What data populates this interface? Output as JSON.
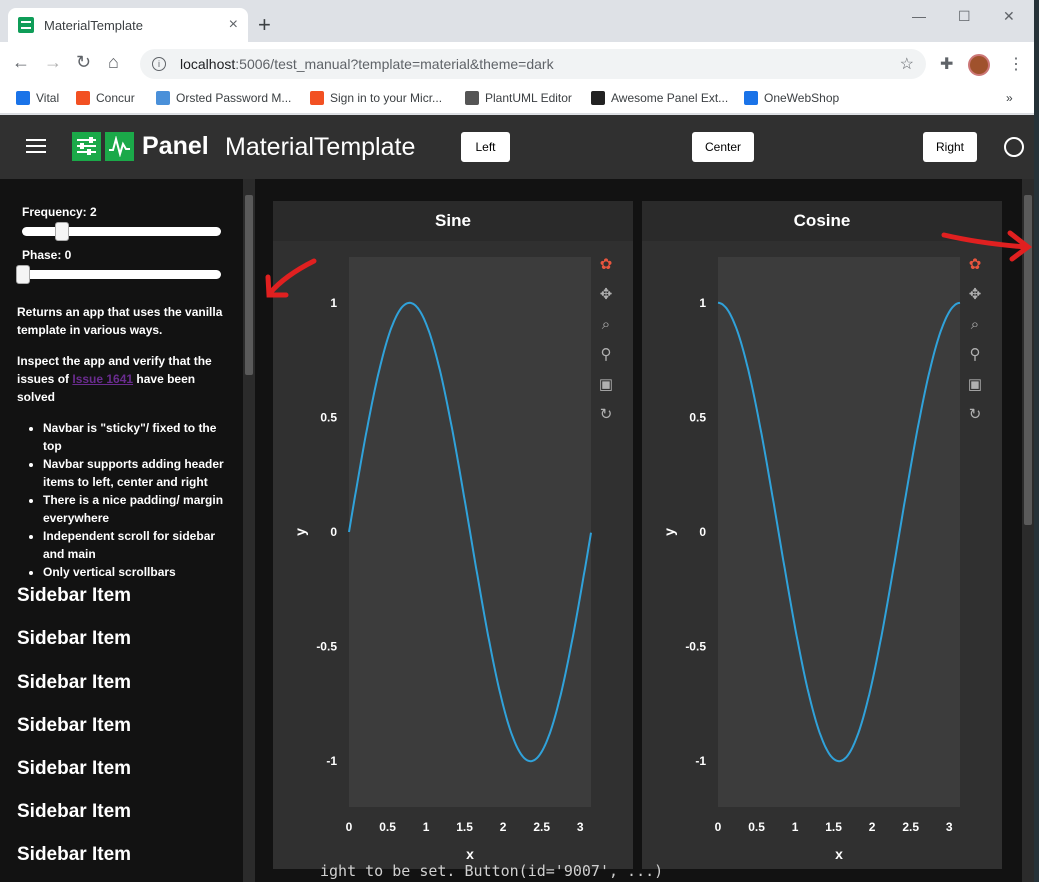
{
  "browser": {
    "tab_title": "MaterialTemplate",
    "tab_close": "×",
    "new_tab": "+",
    "url_host": "localhost",
    "url_path": ":5006/test_manual?template=material&theme=dark",
    "bookmarks": [
      {
        "label": "Vital",
        "color": "#1a73e8"
      },
      {
        "label": "Concur",
        "color": "#f25022"
      },
      {
        "label": "Orsted Password M...",
        "color": "#4a90d9"
      },
      {
        "label": "Sign in to your Micr...",
        "color": "#f25022"
      },
      {
        "label": "PlantUML Editor",
        "color": "#555555"
      },
      {
        "label": "Awesome Panel Ext...",
        "color": "#222222"
      },
      {
        "label": "OneWebShop",
        "color": "#1a73e8"
      }
    ],
    "bookmarks_more": "»"
  },
  "header": {
    "logo_text": "Panel",
    "title": "MaterialTemplate",
    "left_button": "Left",
    "center_button": "Center",
    "right_button": "Right"
  },
  "sidebar": {
    "frequency_label": "Frequency: 2",
    "frequency_value": 2,
    "phase_label": "Phase: 0",
    "phase_value": 0,
    "desc1": "Returns an app that uses the vanilla template in various ways.",
    "desc2_pre": "Inspect the app and verify that the issues of ",
    "desc2_link": "Issue 1641",
    "desc2_post": " have been solved",
    "bullets": [
      "Navbar is \"sticky\"/ fixed to the top",
      "Navbar supports adding header items to left, center and right",
      "There is a nice padding/ margin everywhere",
      "Independent scroll for sidebar and main",
      "Only vertical scrollbars"
    ],
    "items": [
      "Sidebar Item",
      "Sidebar Item",
      "Sidebar Item",
      "Sidebar Item",
      "Sidebar Item",
      "Sidebar Item",
      "Sidebar Item"
    ]
  },
  "chart_data": [
    {
      "type": "line",
      "title": "Sine",
      "xlabel": "x",
      "ylabel": "y",
      "xlim": [
        0,
        3.14
      ],
      "ylim": [
        -1.2,
        1.2
      ],
      "xticks": [
        "0",
        "0.5",
        "1",
        "1.5",
        "2",
        "2.5",
        "3"
      ],
      "yticks": [
        "1",
        "0.5",
        "0",
        "-0.5",
        "-1"
      ],
      "function": "sin(2x)",
      "color": "#30a2da"
    },
    {
      "type": "line",
      "title": "Cosine",
      "xlabel": "x",
      "ylabel": "y",
      "xlim": [
        0,
        3.14
      ],
      "ylim": [
        -1.2,
        1.2
      ],
      "xticks": [
        "0",
        "0.5",
        "1",
        "1.5",
        "2",
        "2.5",
        "3"
      ],
      "yticks": [
        "1",
        "0.5",
        "0",
        "-0.5",
        "-1"
      ],
      "function": "cos(2x)",
      "color": "#30a2da"
    }
  ],
  "terminal_text": "ight to be set. Button(id='9007', ...)"
}
